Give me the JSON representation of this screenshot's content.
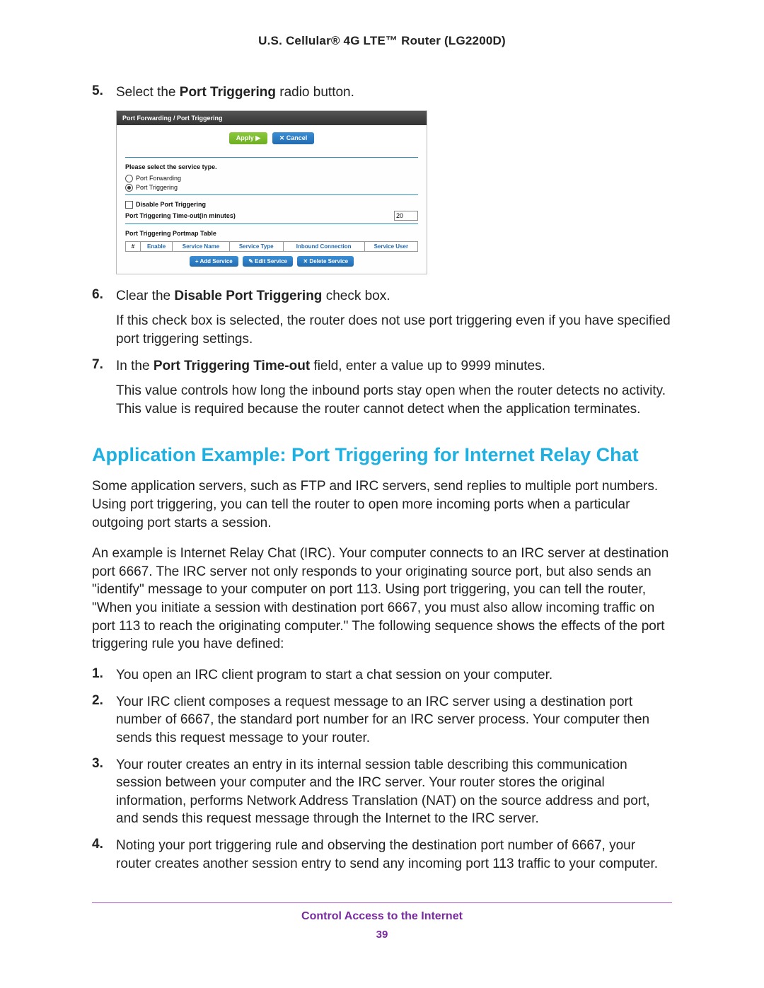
{
  "header": {
    "title": "U.S. Cellular® 4G LTE™ Router (LG2200D)"
  },
  "steps": {
    "s5_pre": "Select the ",
    "s5_bold": "Port Triggering",
    "s5_post": " radio button.",
    "s6_pre": "Clear the ",
    "s6_bold": "Disable Port Triggering",
    "s6_post": " check box.",
    "s6_sub": "If this check box is selected, the router does not use port triggering even if you have specified port triggering settings.",
    "s7_pre": "In the ",
    "s7_bold": "Port Triggering Time-out",
    "s7_post": " field, enter a value up to 9999 minutes.",
    "s7_sub": "This value controls how long the inbound ports stay open when the router detects no activity. This value is required because the router cannot detect when the application terminates."
  },
  "router_ui": {
    "title": "Port Forwarding / Port Triggering",
    "apply": "Apply ▶",
    "cancel": "✕ Cancel",
    "service_heading": "Please select the service type.",
    "opt_forwarding": "Port Forwarding",
    "opt_triggering": "Port Triggering",
    "disable_label": "Disable Port Triggering",
    "timeout_label": "Port Triggering Time-out(in minutes)",
    "timeout_value": "20",
    "portmap_heading": "Port Triggering Portmap Table",
    "th_hash": "#",
    "th_enable": "Enable",
    "th_service_name": "Service Name",
    "th_service_type": "Service Type",
    "th_inbound": "Inbound Connection",
    "th_service_user": "Service User",
    "add": "+ Add Service",
    "edit": "✎ Edit Service",
    "delete": "✕ Delete Service"
  },
  "section_heading": "Application Example: Port Triggering for Internet Relay Chat",
  "para1": "Some application servers, such as FTP and IRC servers, send replies to multiple port numbers. Using port triggering, you can tell the router to open more incoming ports when a particular outgoing port starts a session.",
  "para2": "An example is Internet Relay Chat (IRC). Your computer connects to an IRC server at destination port 6667. The IRC server not only responds to your originating source port, but also sends an \"identify\" message to your computer on port 113. Using port triggering, you can tell the router, \"When you initiate a session with destination port 6667, you must also allow incoming traffic on port 113 to reach the originating computer.\" The following sequence shows the effects of the port triggering rule you have defined:",
  "substeps": {
    "n1": "You open an IRC client program to start a chat session on your computer.",
    "n2": "Your IRC client composes a request message to an IRC server using a destination port number of 6667, the standard port number for an IRC server process. Your computer then sends this request message to your router.",
    "n3": "Your router creates an entry in its internal session table describing this communication session between your computer and the IRC server. Your router stores the original information, performs Network Address Translation (NAT) on the source address and port, and sends this request message through the Internet to the IRC server.",
    "n4": "Noting your port triggering rule and observing the destination port number of 6667, your router creates another session entry to send any incoming port 113 traffic to your computer."
  },
  "footer": {
    "section": "Control Access to the Internet",
    "page": "39"
  }
}
